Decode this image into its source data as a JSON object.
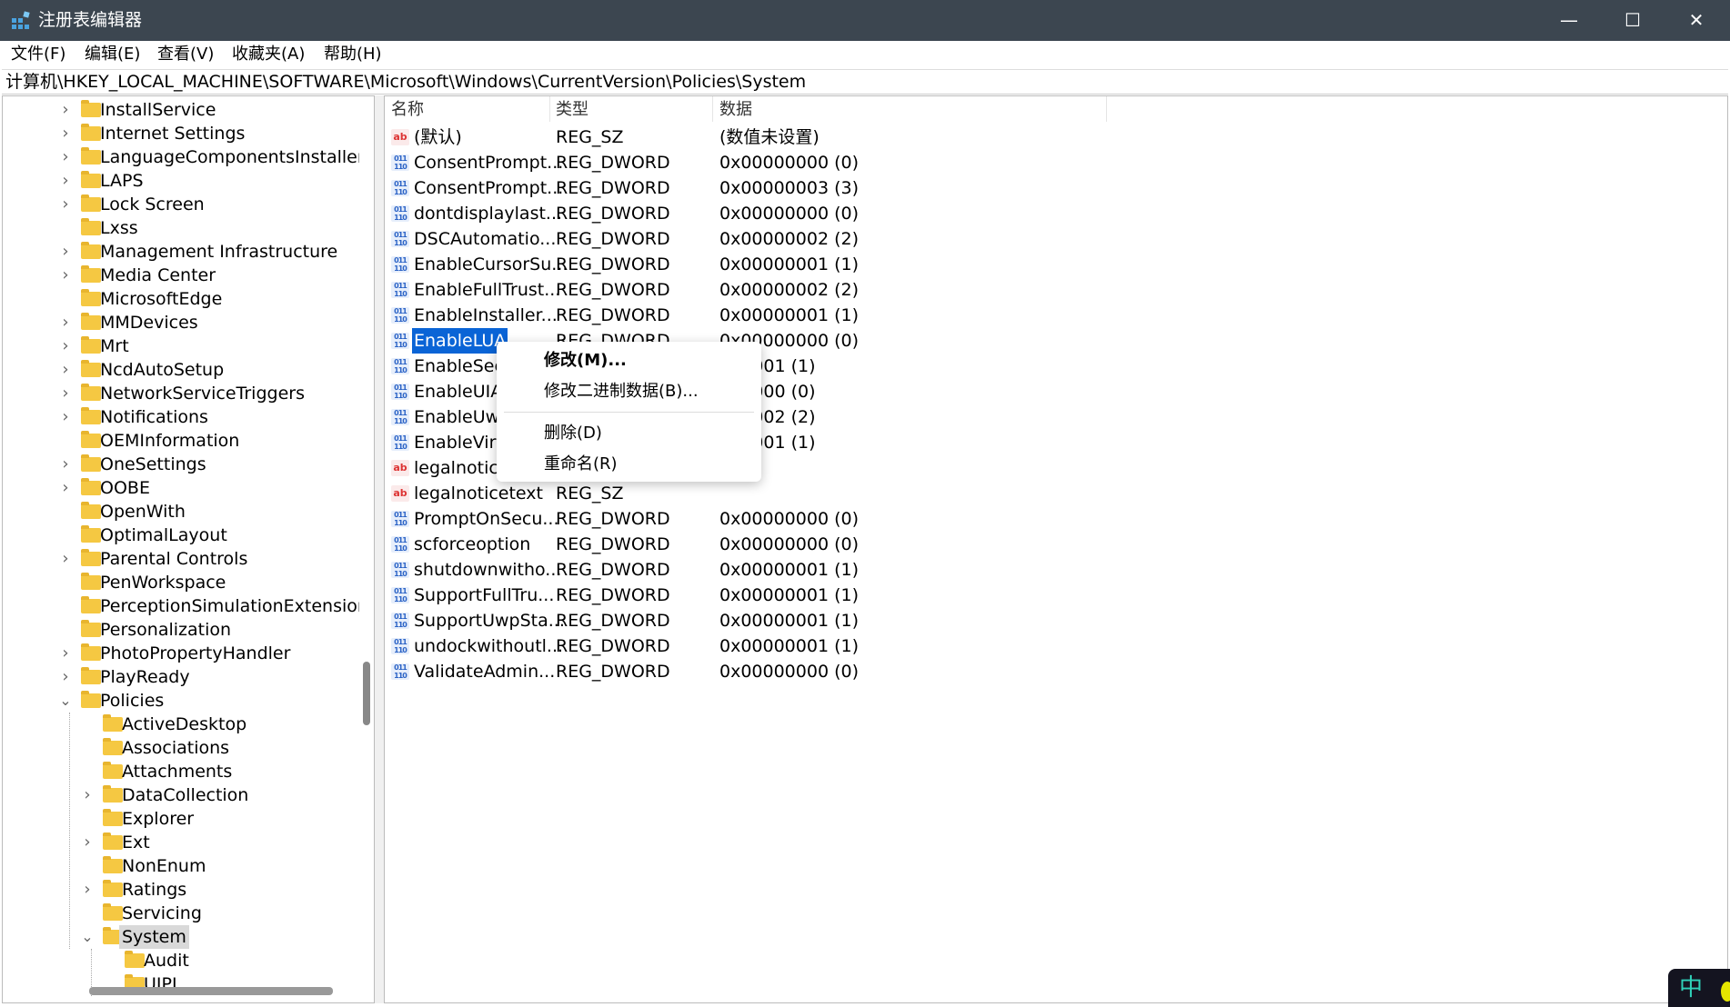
{
  "window": {
    "title": "注册表编辑器",
    "minimize": "—",
    "maximize": "☐",
    "close": "✕"
  },
  "menu": [
    "文件(F)",
    "编辑(E)",
    "查看(V)",
    "收藏夹(A)",
    "帮助(H)"
  ],
  "address": "计算机\\HKEY_LOCAL_MACHINE\\SOFTWARE\\Microsoft\\Windows\\CurrentVersion\\Policies\\System",
  "tree": [
    {
      "label": "InstallService",
      "level": 1,
      "exp": "closed"
    },
    {
      "label": "Internet Settings",
      "level": 1,
      "exp": "closed"
    },
    {
      "label": "LanguageComponentsInstaller",
      "level": 1,
      "exp": "closed"
    },
    {
      "label": "LAPS",
      "level": 1,
      "exp": "closed"
    },
    {
      "label": "Lock Screen",
      "level": 1,
      "exp": "closed"
    },
    {
      "label": "Lxss",
      "level": 1,
      "exp": "none"
    },
    {
      "label": "Management Infrastructure",
      "level": 1,
      "exp": "closed"
    },
    {
      "label": "Media Center",
      "level": 1,
      "exp": "closed"
    },
    {
      "label": "MicrosoftEdge",
      "level": 1,
      "exp": "none"
    },
    {
      "label": "MMDevices",
      "level": 1,
      "exp": "closed"
    },
    {
      "label": "Mrt",
      "level": 1,
      "exp": "closed"
    },
    {
      "label": "NcdAutoSetup",
      "level": 1,
      "exp": "closed"
    },
    {
      "label": "NetworkServiceTriggers",
      "level": 1,
      "exp": "closed"
    },
    {
      "label": "Notifications",
      "level": 1,
      "exp": "closed"
    },
    {
      "label": "OEMInformation",
      "level": 1,
      "exp": "none"
    },
    {
      "label": "OneSettings",
      "level": 1,
      "exp": "closed"
    },
    {
      "label": "OOBE",
      "level": 1,
      "exp": "closed"
    },
    {
      "label": "OpenWith",
      "level": 1,
      "exp": "none"
    },
    {
      "label": "OptimalLayout",
      "level": 1,
      "exp": "none"
    },
    {
      "label": "Parental Controls",
      "level": 1,
      "exp": "closed"
    },
    {
      "label": "PenWorkspace",
      "level": 1,
      "exp": "none"
    },
    {
      "label": "PerceptionSimulationExtensions",
      "level": 1,
      "exp": "none"
    },
    {
      "label": "Personalization",
      "level": 1,
      "exp": "none"
    },
    {
      "label": "PhotoPropertyHandler",
      "level": 1,
      "exp": "closed"
    },
    {
      "label": "PlayReady",
      "level": 1,
      "exp": "closed"
    },
    {
      "label": "Policies",
      "level": 1,
      "exp": "open"
    },
    {
      "label": "ActiveDesktop",
      "level": 2,
      "exp": "none"
    },
    {
      "label": "Associations",
      "level": 2,
      "exp": "none"
    },
    {
      "label": "Attachments",
      "level": 2,
      "exp": "none"
    },
    {
      "label": "DataCollection",
      "level": 2,
      "exp": "closed"
    },
    {
      "label": "Explorer",
      "level": 2,
      "exp": "none"
    },
    {
      "label": "Ext",
      "level": 2,
      "exp": "closed"
    },
    {
      "label": "NonEnum",
      "level": 2,
      "exp": "none"
    },
    {
      "label": "Ratings",
      "level": 2,
      "exp": "closed"
    },
    {
      "label": "Servicing",
      "level": 2,
      "exp": "none"
    },
    {
      "label": "System",
      "level": 2,
      "exp": "open",
      "selected": true
    },
    {
      "label": "Audit",
      "level": 3,
      "exp": "none"
    },
    {
      "label": "UIPI",
      "level": 3,
      "exp": "none"
    }
  ],
  "columns": {
    "name": "名称",
    "type": "类型",
    "data": "数据"
  },
  "values": [
    {
      "name": "(默认)",
      "type": "REG_SZ",
      "data": "(数值未设置)",
      "icon": "sz"
    },
    {
      "name": "ConsentPrompt...",
      "type": "REG_DWORD",
      "data": "0x00000000 (0)",
      "icon": "dw"
    },
    {
      "name": "ConsentPrompt...",
      "type": "REG_DWORD",
      "data": "0x00000003 (3)",
      "icon": "dw"
    },
    {
      "name": "dontdisplaylast...",
      "type": "REG_DWORD",
      "data": "0x00000000 (0)",
      "icon": "dw"
    },
    {
      "name": "DSCAutomatio...",
      "type": "REG_DWORD",
      "data": "0x00000002 (2)",
      "icon": "dw"
    },
    {
      "name": "EnableCursorSu...",
      "type": "REG_DWORD",
      "data": "0x00000001 (1)",
      "icon": "dw"
    },
    {
      "name": "EnableFullTrust...",
      "type": "REG_DWORD",
      "data": "0x00000002 (2)",
      "icon": "dw"
    },
    {
      "name": "EnableInstaller...",
      "type": "REG_DWORD",
      "data": "0x00000001 (1)",
      "icon": "dw"
    },
    {
      "name": "EnableLUA",
      "type": "REG_DWORD",
      "data": "0x00000000 (0)",
      "icon": "dw",
      "selected": true
    },
    {
      "name": "EnableSecu",
      "type": "",
      "data": "000001 (1)",
      "icon": "dw"
    },
    {
      "name": "EnableUIA",
      "type": "",
      "data": "000000 (0)",
      "icon": "dw"
    },
    {
      "name": "EnableUwp",
      "type": "",
      "data": "000002 (2)",
      "icon": "dw"
    },
    {
      "name": "EnableVirt",
      "type": "",
      "data": "000001 (1)",
      "icon": "dw"
    },
    {
      "name": "legalnotice",
      "type": "",
      "data": "",
      "icon": "sz"
    },
    {
      "name": "legalnoticetext",
      "type": "REG_SZ",
      "data": "",
      "icon": "sz"
    },
    {
      "name": "PromptOnSecu...",
      "type": "REG_DWORD",
      "data": "0x00000000 (0)",
      "icon": "dw"
    },
    {
      "name": "scforceoption",
      "type": "REG_DWORD",
      "data": "0x00000000 (0)",
      "icon": "dw"
    },
    {
      "name": "shutdownwitho...",
      "type": "REG_DWORD",
      "data": "0x00000001 (1)",
      "icon": "dw"
    },
    {
      "name": "SupportFullTru...",
      "type": "REG_DWORD",
      "data": "0x00000001 (1)",
      "icon": "dw"
    },
    {
      "name": "SupportUwpSta...",
      "type": "REG_DWORD",
      "data": "0x00000001 (1)",
      "icon": "dw"
    },
    {
      "name": "undockwithoutl...",
      "type": "REG_DWORD",
      "data": "0x00000001 (1)",
      "icon": "dw"
    },
    {
      "name": "ValidateAdmin...",
      "type": "REG_DWORD",
      "data": "0x00000000 (0)",
      "icon": "dw"
    }
  ],
  "context_menu": {
    "modify": "修改(M)...",
    "modify_binary": "修改二进制数据(B)...",
    "delete": "删除(D)",
    "rename": "重命名(R)"
  },
  "icons": {
    "sz": "ab",
    "dw": "011 110"
  },
  "ime": {
    "label": "中"
  },
  "colors": {
    "selection": "#0a64d6",
    "titlebar": "#3c4650"
  }
}
